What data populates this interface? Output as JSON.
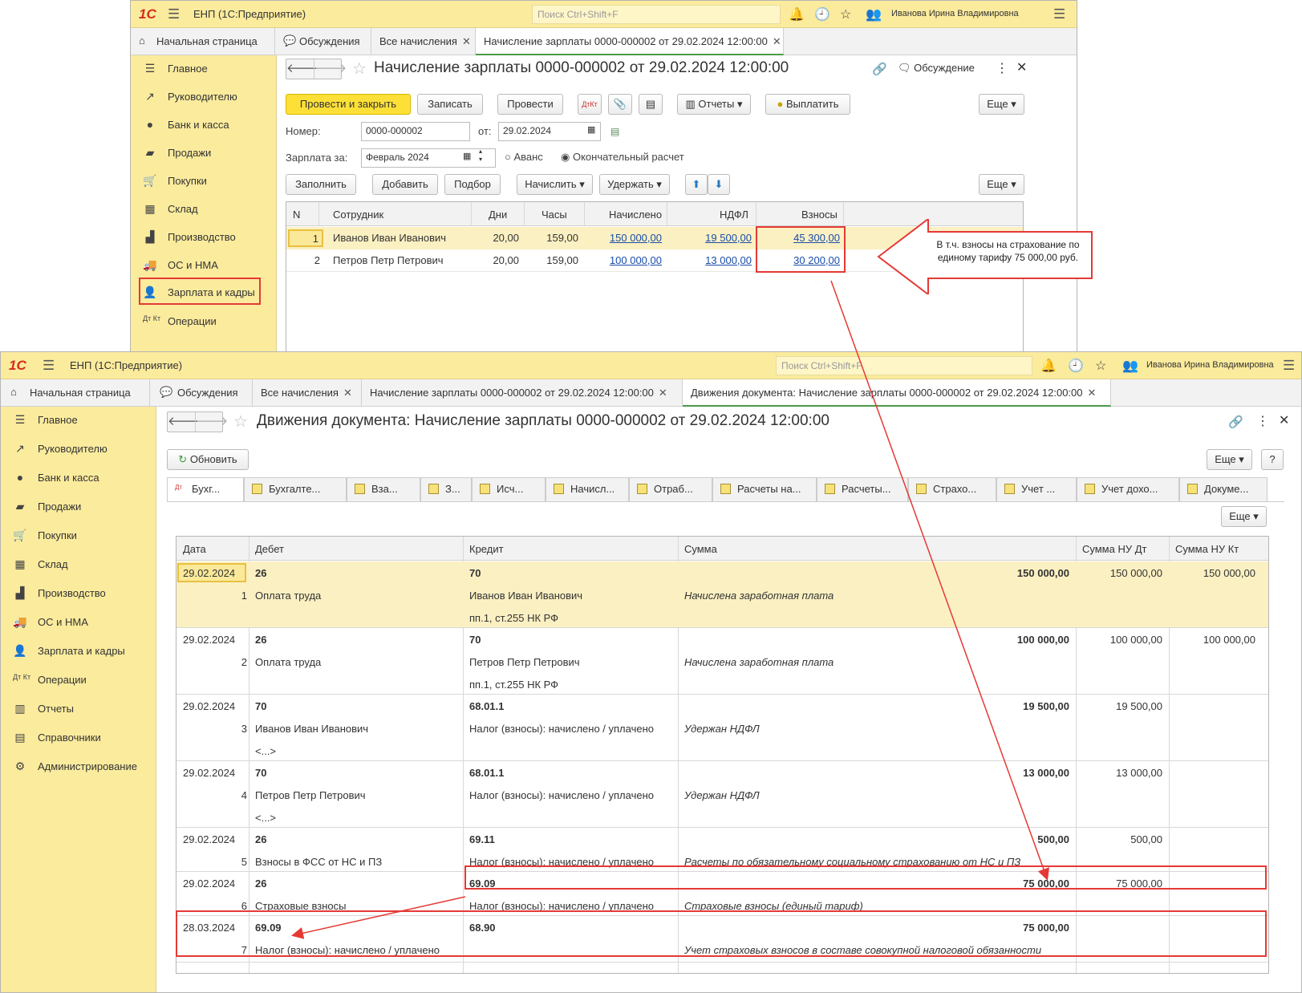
{
  "app": {
    "logo": "1С",
    "title": "ЕНП  (1С:Предприятие)",
    "search_placeholder": "Поиск Ctrl+Shift+F",
    "user": "Иванова Ирина Владимировна"
  },
  "w1": {
    "tabs": [
      "Начальная страница",
      "Обсуждения",
      "Все начисления",
      "Начисление зарплаты 0000-000002 от 29.02.2024 12:00:00"
    ],
    "sidebar": [
      "Главное",
      "Руководителю",
      "Банк и касса",
      "Продажи",
      "Покупки",
      "Склад",
      "Производство",
      "ОС и НМА",
      "Зарплата и кадры",
      "Операции"
    ],
    "title": "Начисление зарплаты 0000-000002 от 29.02.2024 12:00:00",
    "discussion": "Обсуждение",
    "toolbar": {
      "post_close": "Провести и закрыть",
      "save": "Записать",
      "post": "Провести",
      "reports": "Отчеты",
      "pay": "Выплатить",
      "more": "Еще"
    },
    "form": {
      "number_label": "Номер:",
      "number": "0000-000002",
      "from_label": "от:",
      "date": "29.02.2024",
      "salary_label": "Зарплата за:",
      "month": "Февраль 2024",
      "advance": "Аванс",
      "final": "Окончательный расчет"
    },
    "table_toolbar": {
      "fill": "Заполнить",
      "add": "Добавить",
      "select": "Подбор",
      "accrue": "Начислить",
      "withhold": "Удержать",
      "more": "Еще"
    },
    "columns": [
      "N",
      "Сотрудник",
      "Дни",
      "Часы",
      "Начислено",
      "НДФЛ",
      "Взносы"
    ],
    "rows": [
      {
        "n": "1",
        "employee": "Иванов Иван Иванович",
        "days": "20,00",
        "hours": "159,00",
        "accrued": "150 000,00",
        "ndfl": "19 500,00",
        "contrib": "45 300,00"
      },
      {
        "n": "2",
        "employee": "Петров Петр Петрович",
        "days": "20,00",
        "hours": "159,00",
        "accrued": "100 000,00",
        "ndfl": "13 000,00",
        "contrib": "30 200,00"
      }
    ],
    "callout": "В т.ч. взносы на страхование по единому тарифу 75 000,00 руб."
  },
  "w2": {
    "tabs": [
      "Начальная страница",
      "Обсуждения",
      "Все начисления",
      "Начисление зарплаты 0000-000002 от 29.02.2024 12:00:00",
      "Движения документа: Начисление зарплаты 0000-000002 от 29.02.2024 12:00:00"
    ],
    "sidebar": [
      "Главное",
      "Руководителю",
      "Банк и касса",
      "Продажи",
      "Покупки",
      "Склад",
      "Производство",
      "ОС и НМА",
      "Зарплата и кадры",
      "Операции",
      "Отчеты",
      "Справочники",
      "Администрирование"
    ],
    "title": "Движения документа: Начисление зарплаты 0000-000002 от 29.02.2024 12:00:00",
    "refresh": "Обновить",
    "more": "Еще",
    "help": "?",
    "reg_tabs": [
      "Бухг...",
      "Бухгалте...",
      "Вза...",
      "З...",
      "Исч...",
      "Начисл...",
      "Отраб...",
      "Расчеты на...",
      "Расчеты...",
      "Страхо...",
      "Учет ...",
      "Учет дохо...",
      "Докуме..."
    ],
    "columns": [
      "Дата",
      "Дебет",
      "Кредит",
      "Сумма",
      "Сумма НУ Дт",
      "Сумма НУ Кт"
    ],
    "entries": [
      {
        "date": "29.02.2024",
        "n": "1",
        "dt": "26",
        "dt2": "Оплата труда",
        "kt": "70",
        "kt2": "Иванов Иван Иванович",
        "kt3": "пп.1, ст.255 НК РФ",
        "sum": "150 000,00",
        "desc": "Начислена заработная плата",
        "nudt": "150 000,00",
        "nukt": "150 000,00",
        "dt3": ""
      },
      {
        "date": "29.02.2024",
        "n": "2",
        "dt": "26",
        "dt2": "Оплата труда",
        "kt": "70",
        "kt2": "Петров Петр Петрович",
        "kt3": "пп.1, ст.255 НК РФ",
        "sum": "100 000,00",
        "desc": "Начислена заработная плата",
        "nudt": "100 000,00",
        "nukt": "100 000,00",
        "dt3": ""
      },
      {
        "date": "29.02.2024",
        "n": "3",
        "dt": "70",
        "dt2": "Иванов Иван Иванович",
        "dt3": "<...>",
        "kt": "68.01.1",
        "kt2": "Налог (взносы): начислено / уплачено",
        "kt3": "",
        "sum": "19 500,00",
        "desc": "Удержан НДФЛ",
        "nudt": "19 500,00",
        "nukt": ""
      },
      {
        "date": "29.02.2024",
        "n": "4",
        "dt": "70",
        "dt2": "Петров Петр Петрович",
        "dt3": "<...>",
        "kt": "68.01.1",
        "kt2": "Налог (взносы): начислено / уплачено",
        "kt3": "",
        "sum": "13 000,00",
        "desc": "Удержан НДФЛ",
        "nudt": "13 000,00",
        "nukt": ""
      },
      {
        "date": "29.02.2024",
        "n": "5",
        "dt": "26",
        "dt2": "Взносы в ФСС от НС и ПЗ",
        "dt3": "",
        "kt": "69.11",
        "kt2": "Налог (взносы): начислено / уплачено",
        "kt3": "",
        "sum": "500,00",
        "desc": "Расчеты по обязательному социальному страхованию от НС и ПЗ",
        "nudt": "500,00",
        "nukt": ""
      },
      {
        "date": "29.02.2024",
        "n": "6",
        "dt": "26",
        "dt2": "Страховые взносы",
        "dt3": "",
        "kt": "69.09",
        "kt2": "Налог (взносы): начислено / уплачено",
        "kt3": "",
        "sum": "75 000,00",
        "desc": "Страховые взносы (единый тариф)",
        "nudt": "75 000,00",
        "nukt": ""
      },
      {
        "date": "28.03.2024",
        "n": "7",
        "dt": "69.09",
        "dt2": "Налог (взносы): начислено / уплачено",
        "dt3": "",
        "kt": "68.90",
        "kt2": "",
        "kt3": "",
        "sum": "75 000,00",
        "desc": "Учет страховых взносов в составе совокупной налоговой обязанности",
        "nudt": "",
        "nukt": ""
      }
    ]
  },
  "colors": {
    "yellow": "#fbeb9d",
    "accent_button": "#fce038",
    "highlight": "#e53935",
    "link": "#1a4ea8"
  }
}
